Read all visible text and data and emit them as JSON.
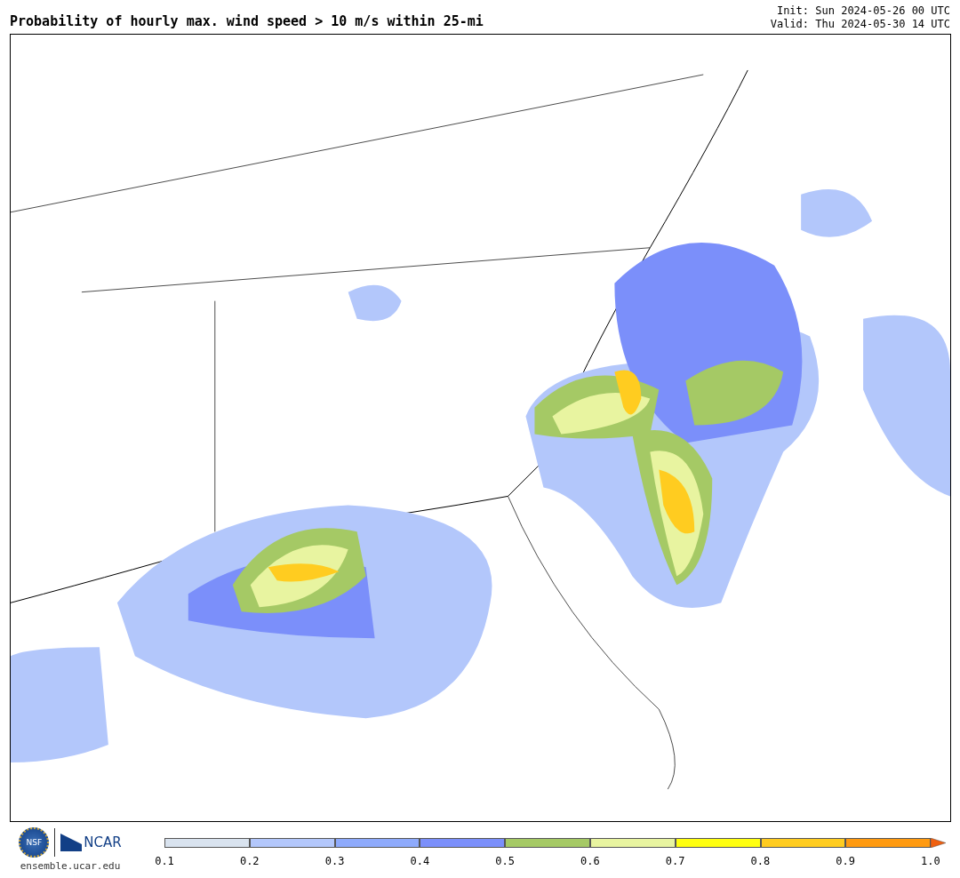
{
  "title": "Probability of hourly max. wind speed > 10 m/s within 25-mi",
  "init": "Init: Sun 2024-05-26 00 UTC",
  "valid": "Valid: Thu 2024-05-30 14 UTC",
  "logos": {
    "nsf": "NSF",
    "ncar": "NCAR",
    "site": "ensemble.ucar.edu"
  },
  "colorbar": {
    "segments": [
      {
        "color": "#d9e3ef"
      },
      {
        "color": "#b3c7fb"
      },
      {
        "color": "#8eaafb"
      },
      {
        "color": "#7b8ffa"
      },
      {
        "color": "#a5c965"
      },
      {
        "color": "#e8f4a0"
      },
      {
        "color": "#ffff10"
      },
      {
        "color": "#ffcc20"
      },
      {
        "color": "#ff9a10"
      }
    ],
    "extend_arrow": {
      "color": "#f06010"
    },
    "ticks": [
      "0.1",
      "0.2",
      "0.3",
      "0.4",
      "0.5",
      "0.6",
      "0.7",
      "0.8",
      "0.9",
      "1.0"
    ]
  }
}
